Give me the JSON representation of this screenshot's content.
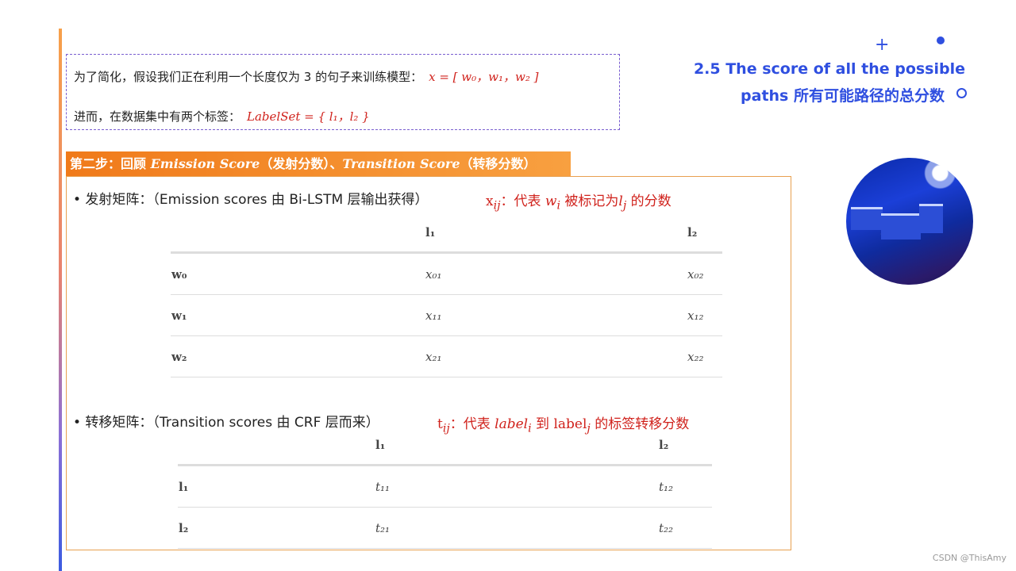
{
  "intro": {
    "line1_text": "为了简化，假设我们正在利用一个长度仅为  3 的句子来训练模型：",
    "line1_math": "x = [ w₀，w₁，w₂ ]",
    "line2_text": "进而，在数据集中有两个标签：",
    "line2_math": "LabelSet = { l₁，l₂ }"
  },
  "title": {
    "line1": "2.5 The score of all the possible",
    "line2": "paths 所有可能路径的总分数"
  },
  "step_banner": {
    "prefix": "第二步：回顾 ",
    "emission": "Emission Score",
    "mid": "（发射分数）、",
    "transition": "Transition Score",
    "suffix": "（转移分数）"
  },
  "emission": {
    "bullet": "•  发射矩阵：（Emission scores 由 Bi-LSTM 层输出获得）",
    "note": "x",
    "note_sub": "ij",
    "note_rest": "：代表 ",
    "note_w": "w",
    "note_w_sub": "i",
    "note_mid": " 被标记为",
    "note_l": "l",
    "note_l_sub": "j",
    "note_end": " 的分数",
    "headers": [
      "",
      "l₁",
      "l₂"
    ],
    "rows": [
      [
        "w₀",
        "x₀₁",
        "x₀₂"
      ],
      [
        "w₁",
        "x₁₁",
        "x₁₂"
      ],
      [
        "w₂",
        "x₂₁",
        "x₂₂"
      ]
    ]
  },
  "transition": {
    "bullet": "•  转移矩阵：（Transition scores 由 CRF 层而来）",
    "note": "t",
    "note_sub": "ij",
    "note_rest": "：代表 ",
    "note_label": "label",
    "note_label_sub": "i",
    "note_mid": " 到 label",
    "note_j": "j",
    "note_end": " 的标签转移分数",
    "headers": [
      "",
      "l₁",
      "l₂"
    ],
    "rows": [
      [
        "l₁",
        "t₁₁",
        "t₁₂"
      ],
      [
        "l₂",
        "t₂₁",
        "t₂₂"
      ]
    ]
  },
  "footer": "CSDN @ThisAmy",
  "colors": {
    "accent_blue": "#2f4fe0",
    "accent_orange": "#f07a1a",
    "note_red": "#d0221c"
  }
}
